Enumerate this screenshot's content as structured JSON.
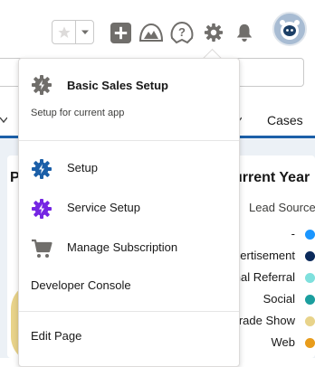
{
  "header": {
    "favorites_star_icon": "star-icon",
    "favorites_dropdown_icon": "chevron-down-icon",
    "add_icon": "plus-icon",
    "trailhead_icon": "trailhead-icon",
    "help_icon": "help-icon",
    "setup_icon": "gear-icon",
    "notifications_icon": "bell-icon",
    "avatar_icon": "astro-avatar"
  },
  "background": {
    "nav_tab_cases": "Cases",
    "card_title_partial_left": "P",
    "card_title_partial_right": "urrent Year",
    "legend_title": "Lead Source",
    "legend": [
      {
        "label": "-",
        "color": "#1b96ff"
      },
      {
        "label": "ertisement",
        "color": "#0b2a5b"
      },
      {
        "label": "nal Referral",
        "color": "#7fe0dd"
      },
      {
        "label": "Social",
        "color": "#1b9e9e"
      },
      {
        "label": "rade Show",
        "color": "#e8d38a"
      },
      {
        "label": "Web",
        "color": "#e89c1b"
      }
    ]
  },
  "menu": {
    "title": "Basic Sales Setup",
    "subtitle": "Setup for current app",
    "items": [
      {
        "label": "Setup",
        "icon": "setup-gear-icon",
        "color": "#1b5fa8"
      },
      {
        "label": "Service Setup",
        "icon": "service-setup-gear-icon",
        "color": "#7526e3"
      },
      {
        "label": "Manage Subscription",
        "icon": "shopping-cart-icon",
        "color": "#706e6b"
      },
      {
        "label": "Developer Console"
      },
      {
        "label": "Edit Page"
      }
    ]
  }
}
